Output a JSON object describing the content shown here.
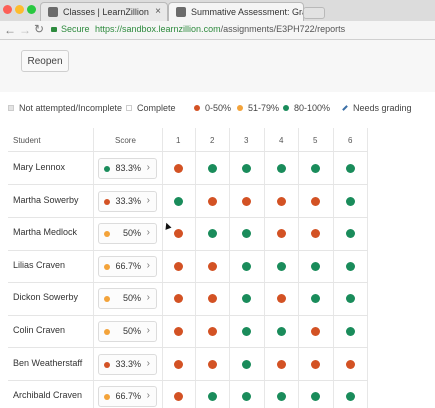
{
  "browser": {
    "tabs": [
      {
        "label": "Classes | LearnZillion",
        "active": false
      },
      {
        "label": "Summative Assessment: Grad",
        "active": true
      }
    ],
    "secure_label": "Secure",
    "url_host": "https://sandbox.learnzillion.com",
    "url_path": "/assignments/E3PH722/reports"
  },
  "toolbar": {
    "reopen_label": "Reopen"
  },
  "legend": {
    "not_attempted": "Not attempted/Incomplete",
    "complete": "Complete",
    "low": "0-50%",
    "mid": "51-79%",
    "high": "80-100%",
    "needs_grading": "Needs grading"
  },
  "colors": {
    "low": "#d35224",
    "mid": "#f3a33a",
    "high": "#1a8c5b",
    "untouched": "#dedede"
  },
  "table": {
    "student_header": "Student",
    "score_header": "Score",
    "question_headers": [
      "1",
      "2",
      "3",
      "4",
      "5",
      "6"
    ],
    "rows": [
      {
        "name": "Mary Lennox",
        "score": "83.3%",
        "level": "high",
        "results": [
          "low",
          "high",
          "high",
          "high",
          "high",
          "high"
        ]
      },
      {
        "name": "Martha Sowerby",
        "score": "33.3%",
        "level": "low",
        "results": [
          "high",
          "low",
          "low",
          "low",
          "low",
          "high"
        ]
      },
      {
        "name": "Martha Medlock",
        "score": "50%",
        "level": "mid",
        "results": [
          "low",
          "high",
          "high",
          "low",
          "low",
          "high"
        ]
      },
      {
        "name": "Lilias Craven",
        "score": "66.7%",
        "level": "mid",
        "results": [
          "low",
          "low",
          "high",
          "high",
          "high",
          "high"
        ]
      },
      {
        "name": "Dickon Sowerby",
        "score": "50%",
        "level": "mid",
        "results": [
          "low",
          "low",
          "high",
          "low",
          "high",
          "high"
        ]
      },
      {
        "name": "Colin Craven",
        "score": "50%",
        "level": "mid",
        "results": [
          "low",
          "low",
          "high",
          "high",
          "low",
          "high"
        ]
      },
      {
        "name": "Ben Weatherstaff",
        "score": "33.3%",
        "level": "low",
        "results": [
          "low",
          "low",
          "high",
          "low",
          "low",
          "low"
        ]
      },
      {
        "name": "Archibald Craven",
        "score": "66.7%",
        "level": "mid",
        "results": [
          "low",
          "high",
          "high",
          "high",
          "high",
          "high"
        ]
      }
    ]
  }
}
